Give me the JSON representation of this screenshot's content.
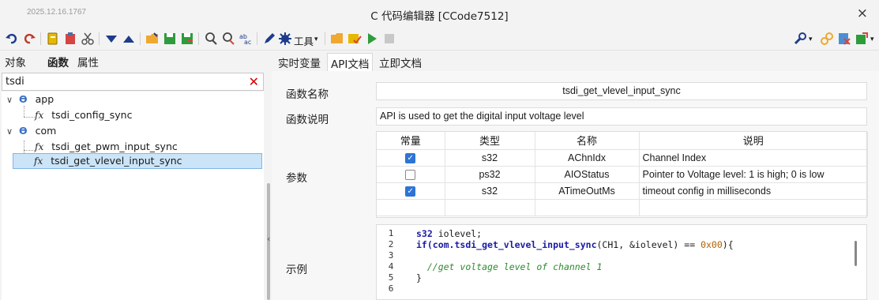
{
  "window": {
    "version_text": "2025.12.16.1767",
    "title": "C 代码编辑器 [CCode7512]",
    "close_glyph": "×"
  },
  "toolbar": {
    "tools_label": "工具",
    "icons": [
      "undo-icon",
      "redo-icon",
      "copy-icon",
      "paste-icon",
      "cut-icon",
      "move-down-icon",
      "move-up-icon",
      "open-folder-icon",
      "save-icon",
      "save-as-icon",
      "find-icon",
      "find-next-icon",
      "replace-icon",
      "edit-icon",
      "gear-icon",
      "folder-icon",
      "check-icon",
      "run-icon",
      "stop-icon",
      "wrench-icon",
      "link-icon",
      "close-file-icon",
      "export-icon"
    ]
  },
  "left_panel": {
    "tabs": [
      {
        "label": "对象"
      },
      {
        "label": "函数"
      },
      {
        "label": "属性"
      }
    ],
    "search_value": "tsdi",
    "tree": [
      {
        "label": "app",
        "kind": "namespace"
      },
      {
        "label": "tsdi_config_sync",
        "kind": "function"
      },
      {
        "label": "com",
        "kind": "namespace"
      },
      {
        "label": "tsdi_get_pwm_input_sync",
        "kind": "function"
      },
      {
        "label": "tsdi_get_vlevel_input_sync",
        "kind": "function",
        "selected": true
      }
    ]
  },
  "right_panel": {
    "tabs": [
      {
        "label": "实时变量"
      },
      {
        "label": "API文档"
      },
      {
        "label": "立即文档"
      }
    ],
    "labels": {
      "func_name": "函数名称",
      "func_desc": "函数说明",
      "params": "参数",
      "example": "示例"
    },
    "func_name": "tsdi_get_vlevel_input_sync",
    "func_desc": "API is used to get the digital input voltage level",
    "param_headers": [
      "常量",
      "类型",
      "名称",
      "说明"
    ],
    "params": [
      {
        "const": true,
        "type": "s32",
        "name": "AChnIdx",
        "desc": "Channel Index"
      },
      {
        "const": false,
        "type": "ps32",
        "name": "AIOStatus",
        "desc": "Pointer to Voltage level: 1 is high; 0 is low"
      },
      {
        "const": true,
        "type": "s32",
        "name": "ATimeOutMs",
        "desc": "timeout config in milliseconds"
      }
    ],
    "code_lines": [
      "1",
      "2",
      "3",
      "4",
      "5",
      "6"
    ],
    "code": {
      "l1_kw": "s32",
      "l1_rest": " iolevel;",
      "l2_kw": "if",
      "l2_fn": "(com.tsdi_get_vlevel_input_sync",
      "l2_rest": "(CH1, &iolevel) == ",
      "l2_num": "0x00",
      "l2_end": "){",
      "l4_comment": "//get voltage level of channel 1",
      "l5": "}"
    }
  },
  "colors": {
    "accent": "#2d74d6",
    "selection": "#cce4f7",
    "clear_red": "#d40000"
  }
}
